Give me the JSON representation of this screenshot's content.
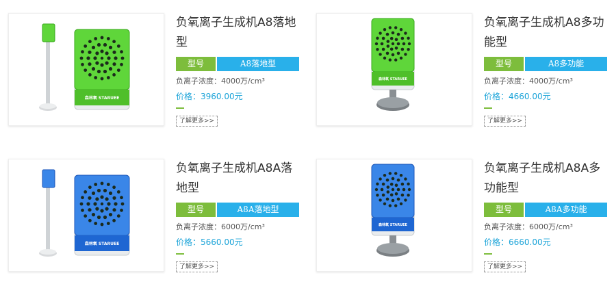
{
  "products": [
    {
      "title": "负氧离子生成机A8落地型",
      "spec_key": "型号",
      "spec_value": "A8落地型",
      "concentration": "负离子浓度：4000万/cm³",
      "price": "价格：3960.00元",
      "more": "了解更多>>",
      "image": {
        "color": "#5fd63a",
        "variant": "floor",
        "brand": "森林氧 STARUEE"
      }
    },
    {
      "title": "负氧离子生成机A8多功能型",
      "spec_key": "型号",
      "spec_value": "A8多功能",
      "concentration": "负离子浓度：4000万/cm³",
      "price": "价格：4660.00元",
      "more": "了解更多>>",
      "image": {
        "color": "#5fd63a",
        "variant": "desk",
        "brand": "森林氧 STARUEE"
      }
    },
    {
      "title": "负氧离子生成机A8A落地型",
      "spec_key": "型号",
      "spec_value": "A8A落地型",
      "concentration": "负离子浓度：6000万/cm³",
      "price": "价格：5660.00元",
      "more": "了解更多>>",
      "image": {
        "color": "#3a86e8",
        "variant": "floor",
        "brand": "森林氧 STARUEE"
      }
    },
    {
      "title": "负氧离子生成机A8A多功能型",
      "spec_key": "型号",
      "spec_value": "A8A多功能",
      "concentration": "负离子浓度：6000万/cm³",
      "price": "价格：6660.00元",
      "more": "了解更多>>",
      "image": {
        "color": "#3a86e8",
        "variant": "desk",
        "brand": "森林氧 STARUEE"
      }
    }
  ]
}
